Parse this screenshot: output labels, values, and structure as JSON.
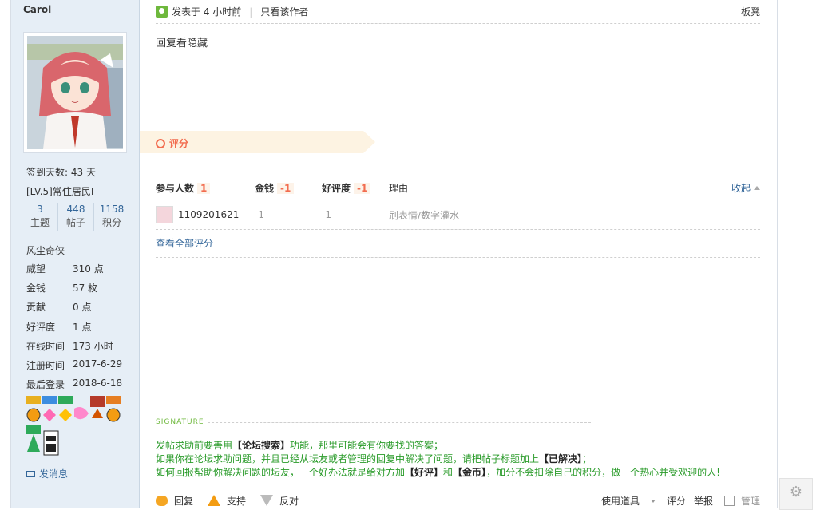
{
  "user": {
    "name": "Carol",
    "signin": "签到天数: 43 天",
    "level": "[LV.5]常住居民I",
    "stats": [
      {
        "num": "3",
        "label": "主题"
      },
      {
        "num": "448",
        "label": "帖子"
      },
      {
        "num": "1158",
        "label": "积分"
      }
    ],
    "title": "风尘奇侠",
    "fields": [
      {
        "k": "威望",
        "v": "310 点"
      },
      {
        "k": "金钱",
        "v": "57 枚"
      },
      {
        "k": "贡献",
        "v": "0 点"
      },
      {
        "k": "好评度",
        "v": "1 点"
      },
      {
        "k": "在线时间",
        "v": "173 小时"
      },
      {
        "k": "注册时间",
        "v": "2017-6-29"
      },
      {
        "k": "最后登录",
        "v": "2018-6-18"
      }
    ],
    "pm": "发消息"
  },
  "post": {
    "posted": "发表于 4 小时前",
    "only_author": "只看该作者",
    "floor": "板凳",
    "content": "回复看隐藏"
  },
  "rating": {
    "label": "评分",
    "head": {
      "participants": "参与人数",
      "participants_count": "1",
      "money": "金钱",
      "money_val": "-1",
      "rep": "好评度",
      "rep_val": "-1",
      "reason": "理由",
      "collapse": "收起"
    },
    "rows": [
      {
        "user": "1109201621",
        "money": "-1",
        "rep": "-1",
        "reason": "刷表情/数字灌水"
      }
    ],
    "view_all": "查看全部评分"
  },
  "signature": {
    "title": "SIGNATURE",
    "l1a": "发帖求助前要善用",
    "l1b": "【论坛搜索】",
    "l1c": "功能，那里可能会有你要找的答案；",
    "l2a": "如果你在论坛求助问题，并且已经从坛友或者管理的回复中解决了问题，请把帖子标题加上",
    "l2b": "【已解决】",
    "l2c": "；",
    "l3a": "如何回报帮助你解决问题的坛友，一个好办法就是给对方加",
    "l3b": "【好评】",
    "l3c": "和",
    "l3d": "【金币】",
    "l3e": "，加分不会扣除自己的积分，做一个热心并受欢迎的人!"
  },
  "footer": {
    "reply": "回复",
    "support": "支持",
    "oppose": "反对",
    "tools": "使用道具",
    "rate": "评分",
    "report": "举报",
    "manage": "管理"
  }
}
